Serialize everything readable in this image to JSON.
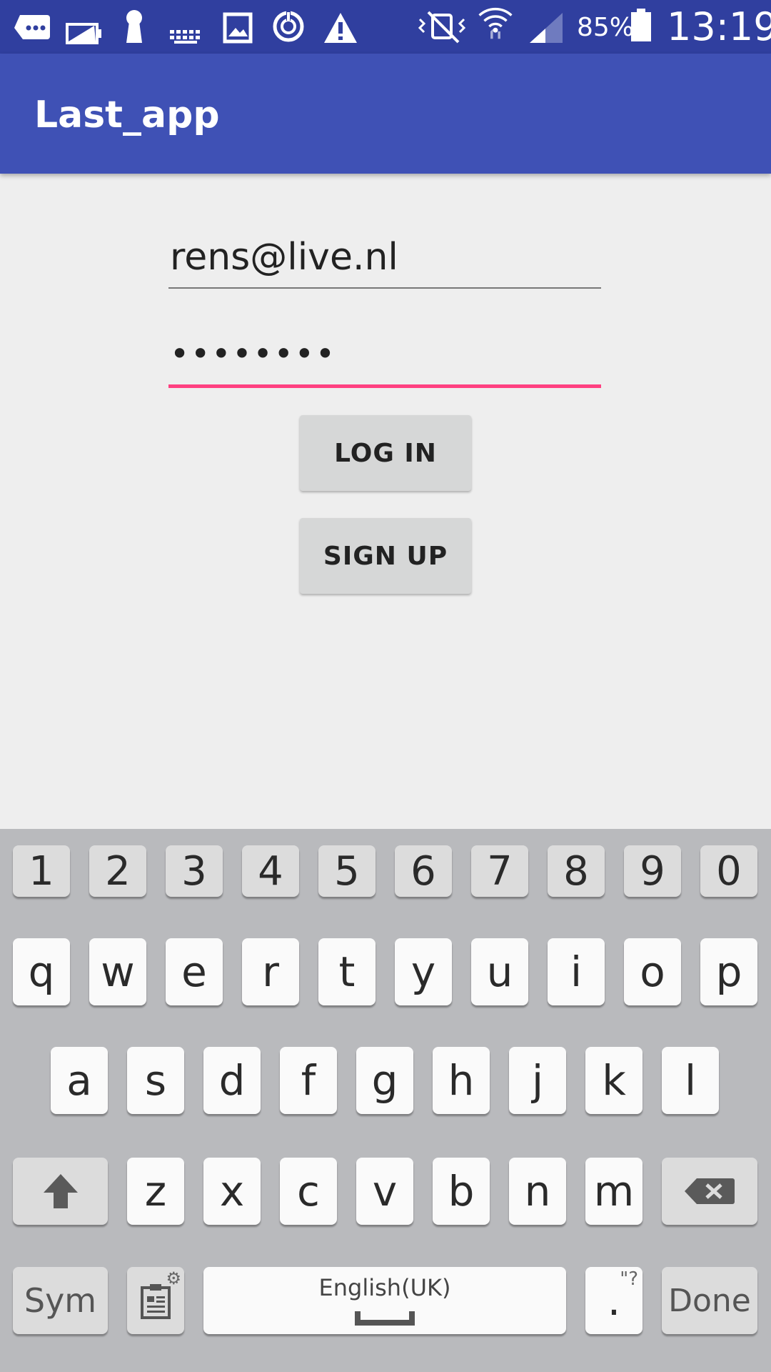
{
  "status_bar": {
    "battery_percent": "85%",
    "time": "13:19",
    "icons": [
      "message-icon",
      "battery-saver-icon",
      "keyhole-icon",
      "keyboard-icon",
      "image-icon",
      "sync-icon",
      "warning-icon",
      "vibrate-mute-icon",
      "wifi-icon",
      "signal-icon",
      "battery-icon"
    ]
  },
  "app_bar": {
    "title": "Last_app"
  },
  "form": {
    "email_value": "rens@live.nl",
    "password_value": "••••••••",
    "login_label": "LOG IN",
    "signup_label": "SIGN UP"
  },
  "keyboard": {
    "numbers": [
      "1",
      "2",
      "3",
      "4",
      "5",
      "6",
      "7",
      "8",
      "9",
      "0"
    ],
    "row1": [
      "q",
      "w",
      "e",
      "r",
      "t",
      "y",
      "u",
      "i",
      "o",
      "p"
    ],
    "row2": [
      "a",
      "s",
      "d",
      "f",
      "g",
      "h",
      "j",
      "k",
      "l"
    ],
    "row3": [
      "z",
      "x",
      "c",
      "v",
      "b",
      "n",
      "m"
    ],
    "sym_label": "Sym",
    "space_label": "English(UK)",
    "period_label": ".",
    "period_sub": "\"?",
    "done_label": "Done",
    "clipboard_sub": "⚙"
  },
  "colors": {
    "status_bar": "#303f9f",
    "app_bar": "#3f51b5",
    "accent": "#ff4081",
    "background": "#eeeeee",
    "keyboard": "#b9babd"
  }
}
